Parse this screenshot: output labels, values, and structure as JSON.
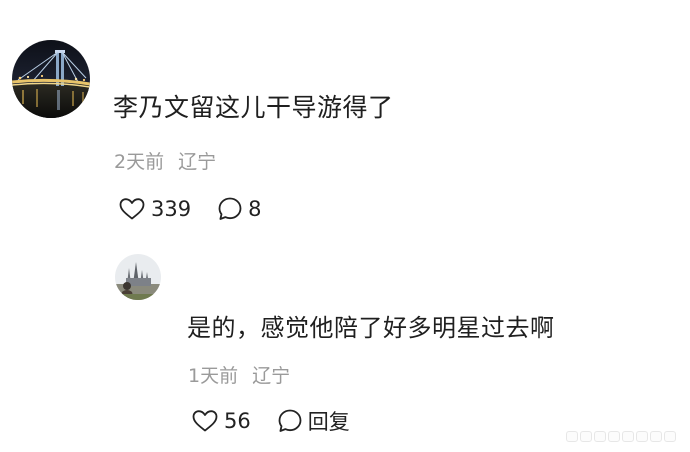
{
  "comment": {
    "text": "李乃文留这儿干导游得了",
    "time": "2天前",
    "location": "辽宁",
    "like_count": "339",
    "reply_count": "8",
    "avatar_icon": "bridge-night-avatar"
  },
  "reply": {
    "text": "是的，感觉他陪了好多明星过去啊",
    "time": "1天前",
    "location": "辽宁",
    "like_count": "56",
    "reply_label": "回复",
    "avatar_icon": "castle-avatar"
  },
  "colors": {
    "text": "#1f1f1f",
    "meta": "#9a9a9a",
    "icon": "#222222",
    "background": "#ffffff"
  }
}
